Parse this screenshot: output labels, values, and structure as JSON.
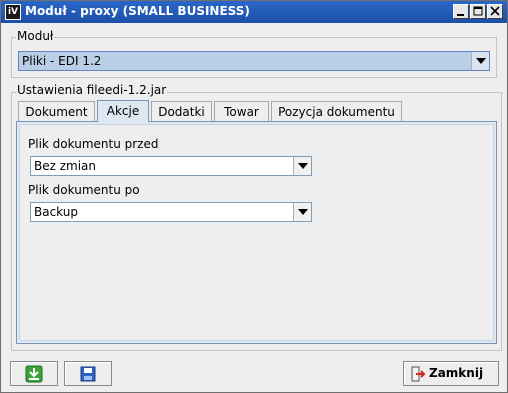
{
  "window": {
    "title": "Moduł - proxy (SMALL BUSINESS)",
    "app_icon_text": "iV"
  },
  "module_group": {
    "legend": "Moduł",
    "selected": "Pliki - EDI 1.2"
  },
  "settings_group": {
    "legend": "Ustawienia fileedi-1.2.jar"
  },
  "tabs": [
    {
      "label": "Dokument",
      "active": false
    },
    {
      "label": "Akcje",
      "active": true
    },
    {
      "label": "Dodatki",
      "active": false
    },
    {
      "label": "Towar",
      "active": false
    },
    {
      "label": "Pozycja dokumentu",
      "active": false
    }
  ],
  "akcje": {
    "before_label": "Plik dokumentu przed",
    "before_value": "Bez zmian",
    "after_label": "Plik dokumentu po",
    "after_value": "Backup"
  },
  "footer": {
    "close_label": "Zamknij"
  },
  "colors": {
    "titlebar": "#1c4fa6",
    "tab_active": "#dde8f3",
    "module_combo_selected": "#b8cfe5"
  },
  "icons": {
    "download": "download-icon",
    "save": "floppy-save-icon",
    "exit": "exit-door-icon"
  }
}
